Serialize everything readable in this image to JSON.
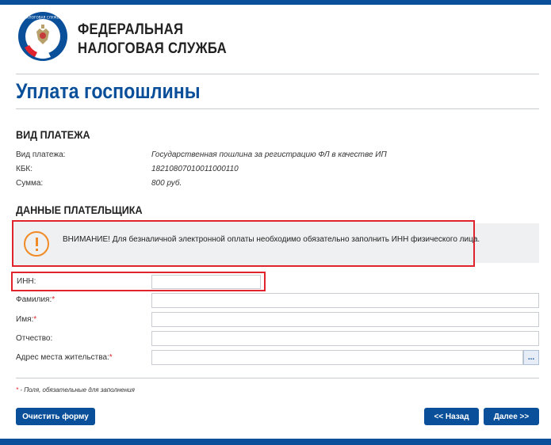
{
  "header": {
    "org_line1": "ФЕДЕРАЛЬНАЯ",
    "org_line2": "НАЛОГОВАЯ СЛУЖБА",
    "emblem_icon": "fns-emblem-icon"
  },
  "page": {
    "title": "Уплата госпошлины"
  },
  "payment": {
    "section_title": "ВИД ПЛАТЕЖА",
    "rows": [
      {
        "label": "Вид платежа:",
        "value": "Государственная пошлина за регистрацию ФЛ в качестве ИП"
      },
      {
        "label": "КБК:",
        "value": "18210807010011000110"
      },
      {
        "label": "Сумма:",
        "value": "800 руб."
      }
    ]
  },
  "payer": {
    "section_title": "ДАННЫЕ ПЛАТЕЛЬЩИКА",
    "warning": "ВНИМАНИЕ! Для безналичной электронной оплаты необходимо обязательно заполнить ИНН физического лица.",
    "warning_icon": "exclamation-circle-icon",
    "fields": {
      "inn": {
        "label": "ИНН:",
        "value": ""
      },
      "surname": {
        "label": "Фамилия:",
        "required_mark": "*",
        "value": ""
      },
      "name": {
        "label": "Имя:",
        "required_mark": "*",
        "value": ""
      },
      "patronymic": {
        "label": "Отчество:",
        "value": ""
      },
      "address": {
        "label": "Адрес места жительства:",
        "required_mark": "*",
        "value": "",
        "picker_label": "..."
      }
    },
    "required_note_mark": "*",
    "required_note": " - Поля, обязательные для заполнения"
  },
  "actions": {
    "clear_label": "Очистить форму",
    "back_label": "<< Назад",
    "next_label": "Далее >>"
  },
  "colors": {
    "brand_blue": "#0a4f99",
    "highlight_red": "#e0232c",
    "warning_orange": "#f08a24"
  }
}
